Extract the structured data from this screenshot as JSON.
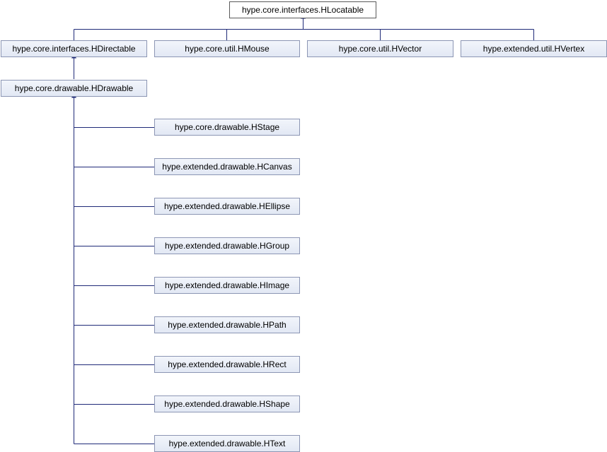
{
  "colors": {
    "edge": "#1f2a78",
    "node_border": "#8c96b4",
    "node_fill": "#e6ebf5",
    "root_fill": "#ffffff"
  },
  "nodes": {
    "hlocatable": "hype.core.interfaces.HLocatable",
    "hdirectable": "hype.core.interfaces.HDirectable",
    "hmouse": "hype.core.util.HMouse",
    "hvector": "hype.core.util.HVector",
    "hvertex": "hype.extended.util.HVertex",
    "hdrawable": "hype.core.drawable.HDrawable",
    "hstage": "hype.core.drawable.HStage",
    "hcanvas": "hype.extended.drawable.HCanvas",
    "hellipse": "hype.extended.drawable.HEllipse",
    "hgroup": "hype.extended.drawable.HGroup",
    "himage": "hype.extended.drawable.HImage",
    "hpath": "hype.extended.drawable.HPath",
    "hrect": "hype.extended.drawable.HRect",
    "hshape": "hype.extended.drawable.HShape",
    "htext": "hype.extended.drawable.HText"
  }
}
